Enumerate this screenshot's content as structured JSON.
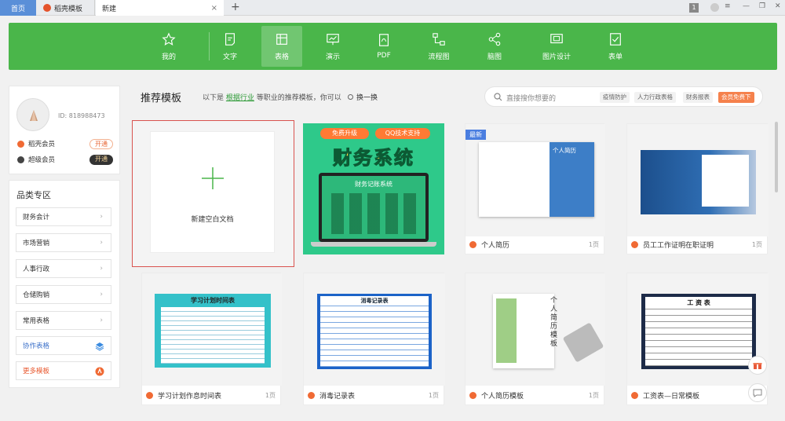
{
  "tabs": {
    "home": "首页",
    "docer": "稻壳模板",
    "new": "新建",
    "close": "×",
    "add": "+"
  },
  "window": {
    "badge": "1",
    "minimize": "—",
    "restore": "❐",
    "close": "✕"
  },
  "toolbar": {
    "items": [
      {
        "label": "我的",
        "icon": "star-icon"
      },
      {
        "label": "文字",
        "icon": "document-icon"
      },
      {
        "label": "表格",
        "icon": "table-icon",
        "active": true
      },
      {
        "label": "演示",
        "icon": "presentation-icon"
      },
      {
        "label": "PDF",
        "icon": "pdf-icon"
      },
      {
        "label": "流程图",
        "icon": "flowchart-icon"
      },
      {
        "label": "脑图",
        "icon": "mindmap-icon"
      },
      {
        "label": "图片设计",
        "icon": "image-design-icon"
      },
      {
        "label": "表单",
        "icon": "form-icon"
      }
    ],
    "accent": "#4ab64a"
  },
  "user": {
    "id": "ID: 818988473",
    "memberships": [
      {
        "label": "稻壳会员",
        "action": "开通",
        "color": "#f06a34"
      },
      {
        "label": "超级会员",
        "action": "开通",
        "color": "#444444"
      }
    ]
  },
  "categories": {
    "title": "品类专区",
    "items": [
      "财务会计",
      "市场营销",
      "人事行政",
      "仓储购销",
      "常用表格"
    ],
    "collab": "协作表格",
    "more": "更多模板"
  },
  "recommend": {
    "title": "推荐模板",
    "sub_prefix": "以下是",
    "sub_link": "根据行业",
    "sub_suffix": "等职业的推荐模板，你可以",
    "swap": "换一换"
  },
  "search": {
    "placeholder": "直接搜你想要的",
    "tags": [
      "疫情防护",
      "人力行政表格",
      "财务报表"
    ],
    "vip": "会员免费下"
  },
  "blank": {
    "label": "新建空白文档"
  },
  "templates": [
    {
      "title": "免费升级 QQ技术支持 财务系统",
      "banner1": "免费升级",
      "banner2": "QQ技术支持",
      "headline": "财务系统",
      "screen_title": "财务记账系统"
    },
    {
      "title": "个人简历",
      "pages": "1页",
      "badge": "最新",
      "thumb_title": "个人简历"
    },
    {
      "title": "员工工作证明在职证明",
      "pages": "1页"
    },
    {
      "title": "学习计划作息时间表",
      "pages": "1页",
      "thumb_title": "学习计划时间表"
    },
    {
      "title": "消毒记录表",
      "pages": "1页",
      "thumb_title": "消毒记录表"
    },
    {
      "title": "个人简历模板",
      "pages": "1页",
      "thumb_title": "个人简历模板"
    },
    {
      "title": "工资表—日常模板",
      "pages": "1页",
      "thumb_title": "工 资 表"
    }
  ]
}
